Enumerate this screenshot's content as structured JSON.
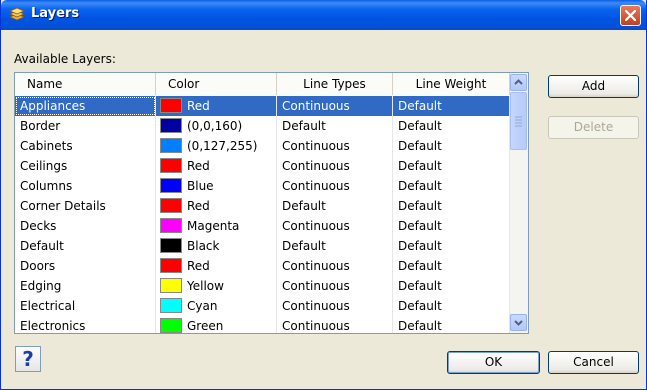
{
  "window": {
    "title": "Layers"
  },
  "label_available": "Available Layers:",
  "columns": {
    "name": "Name",
    "color": "Color",
    "line_types": "Line Types",
    "line_weight": "Line Weight"
  },
  "layers": [
    {
      "name": "Appliances",
      "color_hex": "#ff0000",
      "color_label": "Red",
      "line_type": "Continuous",
      "line_weight": "Default",
      "selected": true
    },
    {
      "name": "Border",
      "color_hex": "#0000a0",
      "color_label": "(0,0,160)",
      "line_type": "Default",
      "line_weight": "Default"
    },
    {
      "name": "Cabinets",
      "color_hex": "#007fff",
      "color_label": "(0,127,255)",
      "line_type": "Continuous",
      "line_weight": "Default"
    },
    {
      "name": "Ceilings",
      "color_hex": "#ff0000",
      "color_label": "Red",
      "line_type": "Continuous",
      "line_weight": "Default"
    },
    {
      "name": "Columns",
      "color_hex": "#0000ff",
      "color_label": "Blue",
      "line_type": "Continuous",
      "line_weight": "Default"
    },
    {
      "name": "Corner Details",
      "color_hex": "#ff0000",
      "color_label": "Red",
      "line_type": "Default",
      "line_weight": "Default"
    },
    {
      "name": "Decks",
      "color_hex": "#ff00ff",
      "color_label": "Magenta",
      "line_type": "Continuous",
      "line_weight": "Default"
    },
    {
      "name": "Default",
      "color_hex": "#000000",
      "color_label": "Black",
      "line_type": "Default",
      "line_weight": "Default"
    },
    {
      "name": "Doors",
      "color_hex": "#ff0000",
      "color_label": "Red",
      "line_type": "Continuous",
      "line_weight": "Default"
    },
    {
      "name": "Edging",
      "color_hex": "#ffff00",
      "color_label": "Yellow",
      "line_type": "Continuous",
      "line_weight": "Default"
    },
    {
      "name": "Electrical",
      "color_hex": "#00ffff",
      "color_label": "Cyan",
      "line_type": "Continuous",
      "line_weight": "Default"
    },
    {
      "name": "Electronics",
      "color_hex": "#00ff00",
      "color_label": "Green",
      "line_type": "Continuous",
      "line_weight": "Default"
    }
  ],
  "buttons": {
    "add": "Add",
    "delete": "Delete",
    "ok": "OK",
    "cancel": "Cancel",
    "help": "?"
  },
  "icons": {
    "title": "layers-icon",
    "close": "close-icon",
    "scroll_up": "chevron-up-icon",
    "scroll_down": "chevron-down-icon"
  },
  "colors": {
    "selection": "#316ac5",
    "titlebar": "#0054e3",
    "close": "#c2401f"
  }
}
